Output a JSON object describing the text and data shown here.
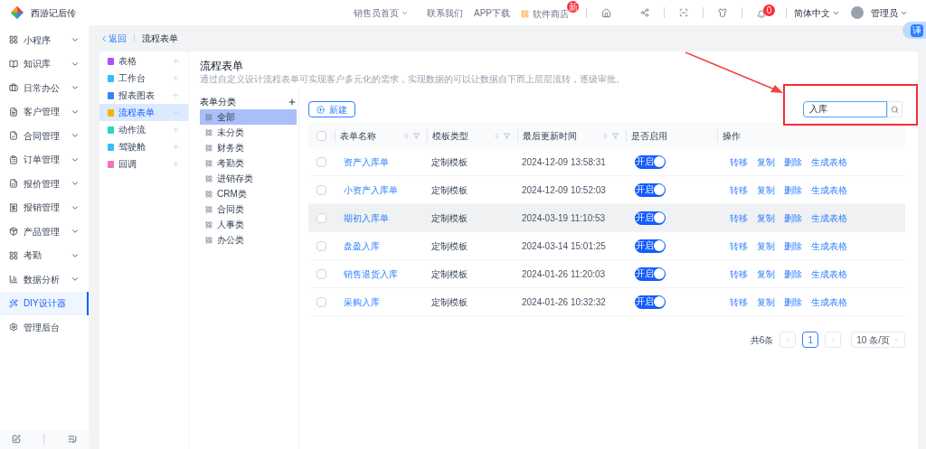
{
  "header": {
    "app_name": "西游记后传",
    "links": [
      {
        "label": "销售员首页",
        "kind": "dropdown"
      },
      {
        "label": "联系我们",
        "kind": "link"
      },
      {
        "label": "APP下载",
        "kind": "link"
      },
      {
        "label": "软件商店",
        "kind": "store",
        "badge": "新"
      }
    ],
    "bell_badge": "0",
    "language": "简体中文",
    "user": "管理员"
  },
  "sidebar": {
    "items": [
      {
        "label": "小程序",
        "selected": false,
        "expandable": true
      },
      {
        "label": "知识库",
        "selected": false,
        "expandable": true
      },
      {
        "label": "日常办公",
        "selected": false,
        "expandable": true
      },
      {
        "label": "客户管理",
        "selected": false,
        "expandable": true
      },
      {
        "label": "合同管理",
        "selected": false,
        "expandable": true
      },
      {
        "label": "订单管理",
        "selected": false,
        "expandable": true
      },
      {
        "label": "报价管理",
        "selected": false,
        "expandable": true
      },
      {
        "label": "报销管理",
        "selected": false,
        "expandable": true
      },
      {
        "label": "产品管理",
        "selected": false,
        "expandable": true
      },
      {
        "label": "考勤",
        "selected": false,
        "expandable": true
      },
      {
        "label": "数据分析",
        "selected": false,
        "expandable": true
      },
      {
        "label": "DIY设计器",
        "selected": true,
        "expandable": false
      },
      {
        "label": "管理后台",
        "selected": false,
        "expandable": false
      }
    ]
  },
  "breadcrumb": {
    "back": "返回",
    "current": "流程表单"
  },
  "module_nav": [
    {
      "label": "表格",
      "color": "#a855f7",
      "selected": false
    },
    {
      "label": "工作台",
      "color": "#38bdf8",
      "selected": false
    },
    {
      "label": "报表图表",
      "color": "#3b82f6",
      "selected": false
    },
    {
      "label": "流程表单",
      "color": "#f5b400",
      "selected": true
    },
    {
      "label": "动作流",
      "color": "#2dd4bf",
      "selected": false
    },
    {
      "label": "驾驶舱",
      "color": "#38bdf8",
      "selected": false
    },
    {
      "label": "回调",
      "color": "#f472b6",
      "selected": false
    }
  ],
  "page": {
    "title": "流程表单",
    "description": "通过自定义设计流程表单可实现客户多元化的需求，实现数据的可以让数据自下而上层层流转，逐级审批。"
  },
  "categories": {
    "title": "表单分类",
    "items": [
      {
        "label": "全部",
        "selected": true
      },
      {
        "label": "未分类",
        "selected": false
      },
      {
        "label": "财务类",
        "selected": false
      },
      {
        "label": "考勤类",
        "selected": false
      },
      {
        "label": "进销存类",
        "selected": false
      },
      {
        "label": "CRM类",
        "selected": false
      },
      {
        "label": "合同类",
        "selected": false
      },
      {
        "label": "人事类",
        "selected": false
      },
      {
        "label": "办公类",
        "selected": false
      }
    ]
  },
  "toolbar": {
    "new_button": "新建",
    "search_value": "入库"
  },
  "table": {
    "all_checked": false,
    "columns": [
      {
        "label": "表单名称",
        "sortable": true
      },
      {
        "label": "模板类型",
        "sortable": true
      },
      {
        "label": "最后更新时间",
        "sortable": true
      },
      {
        "label": "是否启用",
        "sortable": false
      },
      {
        "label": "操作",
        "sortable": false
      }
    ],
    "rows": [
      {
        "checked": false,
        "name": "资产入库单",
        "type": "定制模板",
        "updated": "2024-12-09 13:58:31",
        "toggle": "开启",
        "on": true,
        "hovered": false,
        "actions": [
          "转移",
          "复制",
          "删除",
          "生成表格"
        ]
      },
      {
        "checked": false,
        "name": "小资产入库单",
        "type": "定制模板",
        "updated": "2024-12-09 10:52:03",
        "toggle": "开启",
        "on": true,
        "hovered": false,
        "actions": [
          "转移",
          "复制",
          "删除",
          "生成表格"
        ]
      },
      {
        "checked": false,
        "name": "期初入库单",
        "type": "定制模板",
        "updated": "2024-03-19 11:10:53",
        "toggle": "开启",
        "on": true,
        "hovered": true,
        "actions": [
          "转移",
          "复制",
          "删除",
          "生成表格"
        ]
      },
      {
        "checked": false,
        "name": "盘盈入库",
        "type": "定制模板",
        "updated": "2024-03-14 15:01:25",
        "toggle": "开启",
        "on": true,
        "hovered": false,
        "actions": [
          "转移",
          "复制",
          "删除",
          "生成表格"
        ]
      },
      {
        "checked": false,
        "name": "销售退货入库",
        "type": "定制模板",
        "updated": "2024-01-26 11:20:03",
        "toggle": "开启",
        "on": true,
        "hovered": false,
        "actions": [
          "转移",
          "复制",
          "删除",
          "生成表格"
        ]
      },
      {
        "checked": false,
        "name": "采购入库",
        "type": "定制模板",
        "updated": "2024-01-26 10:32:32",
        "toggle": "开启",
        "on": true,
        "hovered": false,
        "actions": [
          "转移",
          "复制",
          "删除",
          "生成表格"
        ]
      }
    ]
  },
  "pagination": {
    "total": "共6条",
    "pages": [
      {
        "label": "1",
        "selected": true
      }
    ],
    "page_size": "10 条/页"
  },
  "translate_button": "译"
}
